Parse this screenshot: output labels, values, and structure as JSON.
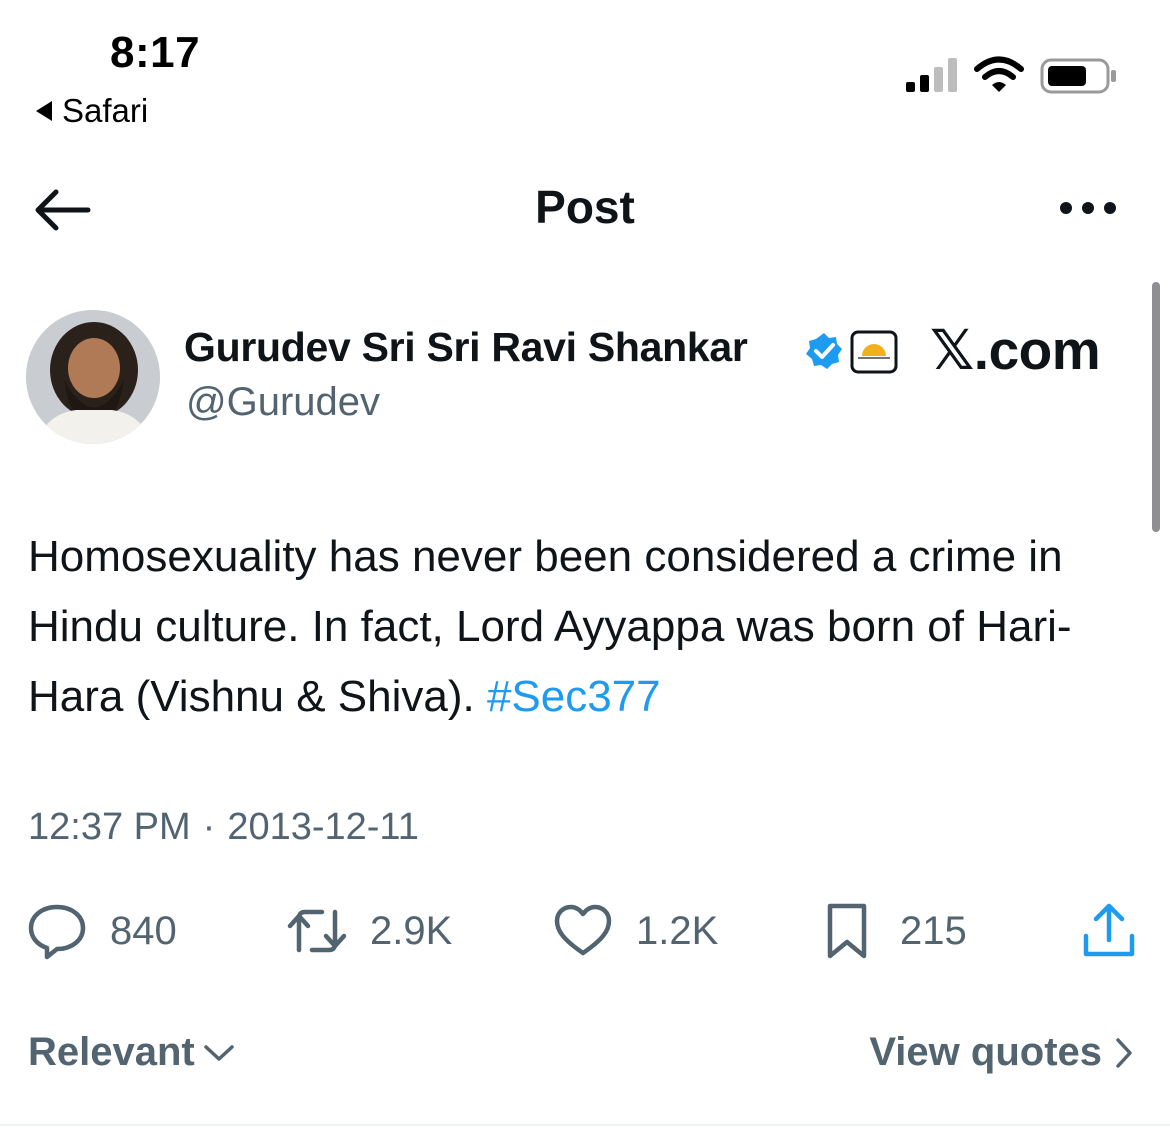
{
  "status_bar": {
    "time": "8:17",
    "back_app": "Safari"
  },
  "nav": {
    "title": "Post",
    "back_icon": "arrow-left-icon",
    "more_icon": "more-horizontal-icon"
  },
  "author": {
    "display_name": "Gurudev Sri Sri Ravi Shankar",
    "handle": "@Gurudev",
    "verified_color": "#1d9bf0"
  },
  "watermark": "𝕏.com",
  "tweet": {
    "text": "Homosexuality has never been considered a crime in Hindu culture. In fact, Lord Ayyappa was born of Hari-Hara (Vishnu & Shiva). ",
    "hashtag": "#Sec377"
  },
  "meta": {
    "time": "12:37 PM",
    "separator": "·",
    "date": "2013-12-11"
  },
  "actions": {
    "replies": "840",
    "retweets": "2.9K",
    "likes": "1.2K",
    "bookmarks": "215"
  },
  "footer": {
    "sort_label": "Relevant",
    "quotes_label": "View quotes"
  },
  "colors": {
    "accent": "#1d9bf0",
    "text": "#0f1419",
    "muted": "#536471"
  }
}
